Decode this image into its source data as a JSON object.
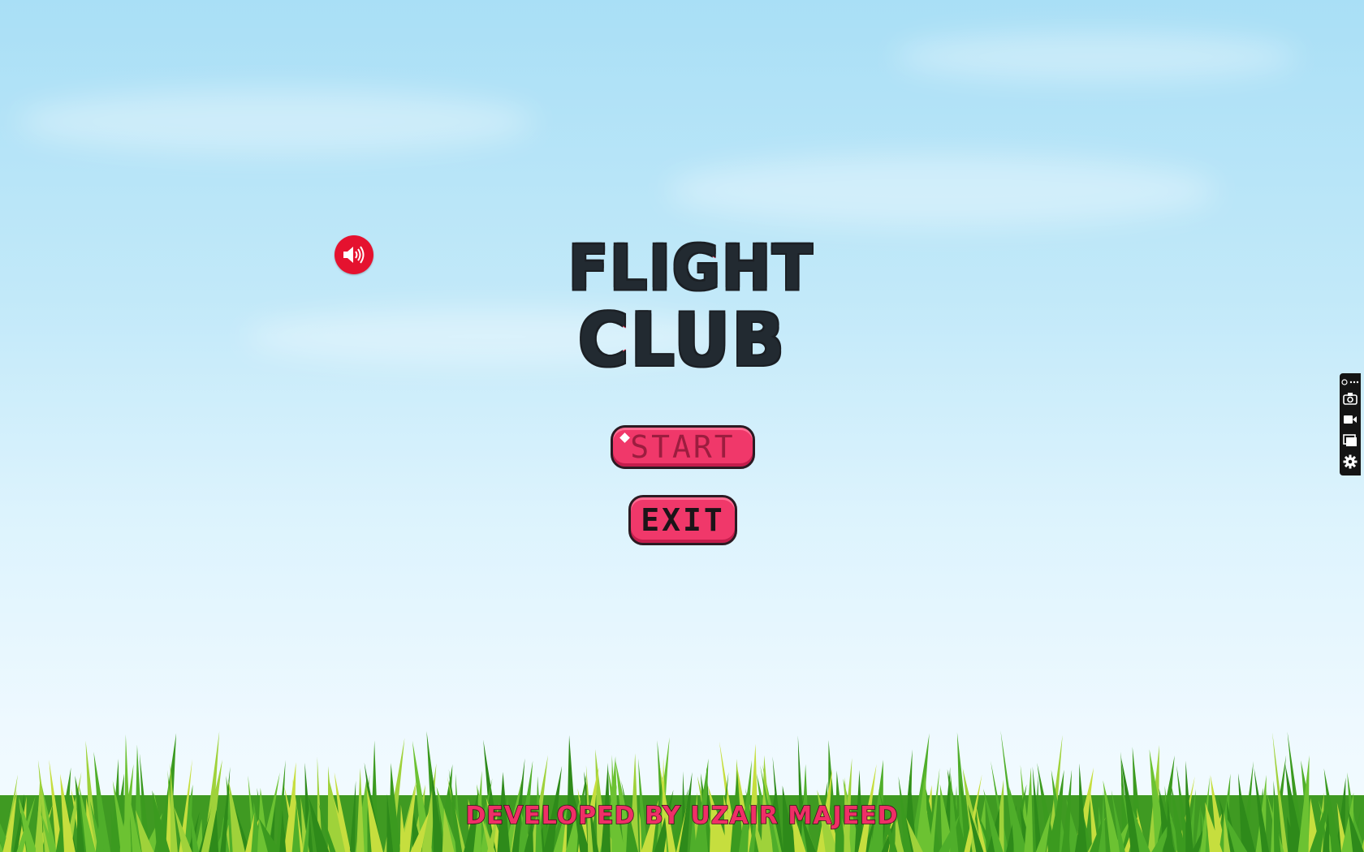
{
  "logo": {
    "line1": "FLIGHT",
    "line2": "CLUB"
  },
  "menu": {
    "start_label": "START",
    "exit_label": "EXIT"
  },
  "sound": {
    "icon": "speaker-on-icon",
    "color": "#e5122f"
  },
  "footer": {
    "credit": "DEVELOPED BY UZAIR MAJEED"
  },
  "side_toolbar": {
    "items": [
      "expand-icon",
      "camera-icon",
      "video-icon",
      "window-icon",
      "gear-icon"
    ]
  },
  "colors": {
    "button": "#f0386a",
    "logo_outline": "#e01b3c",
    "logo_fill": "#222a31",
    "credit": "#ef2f67"
  }
}
